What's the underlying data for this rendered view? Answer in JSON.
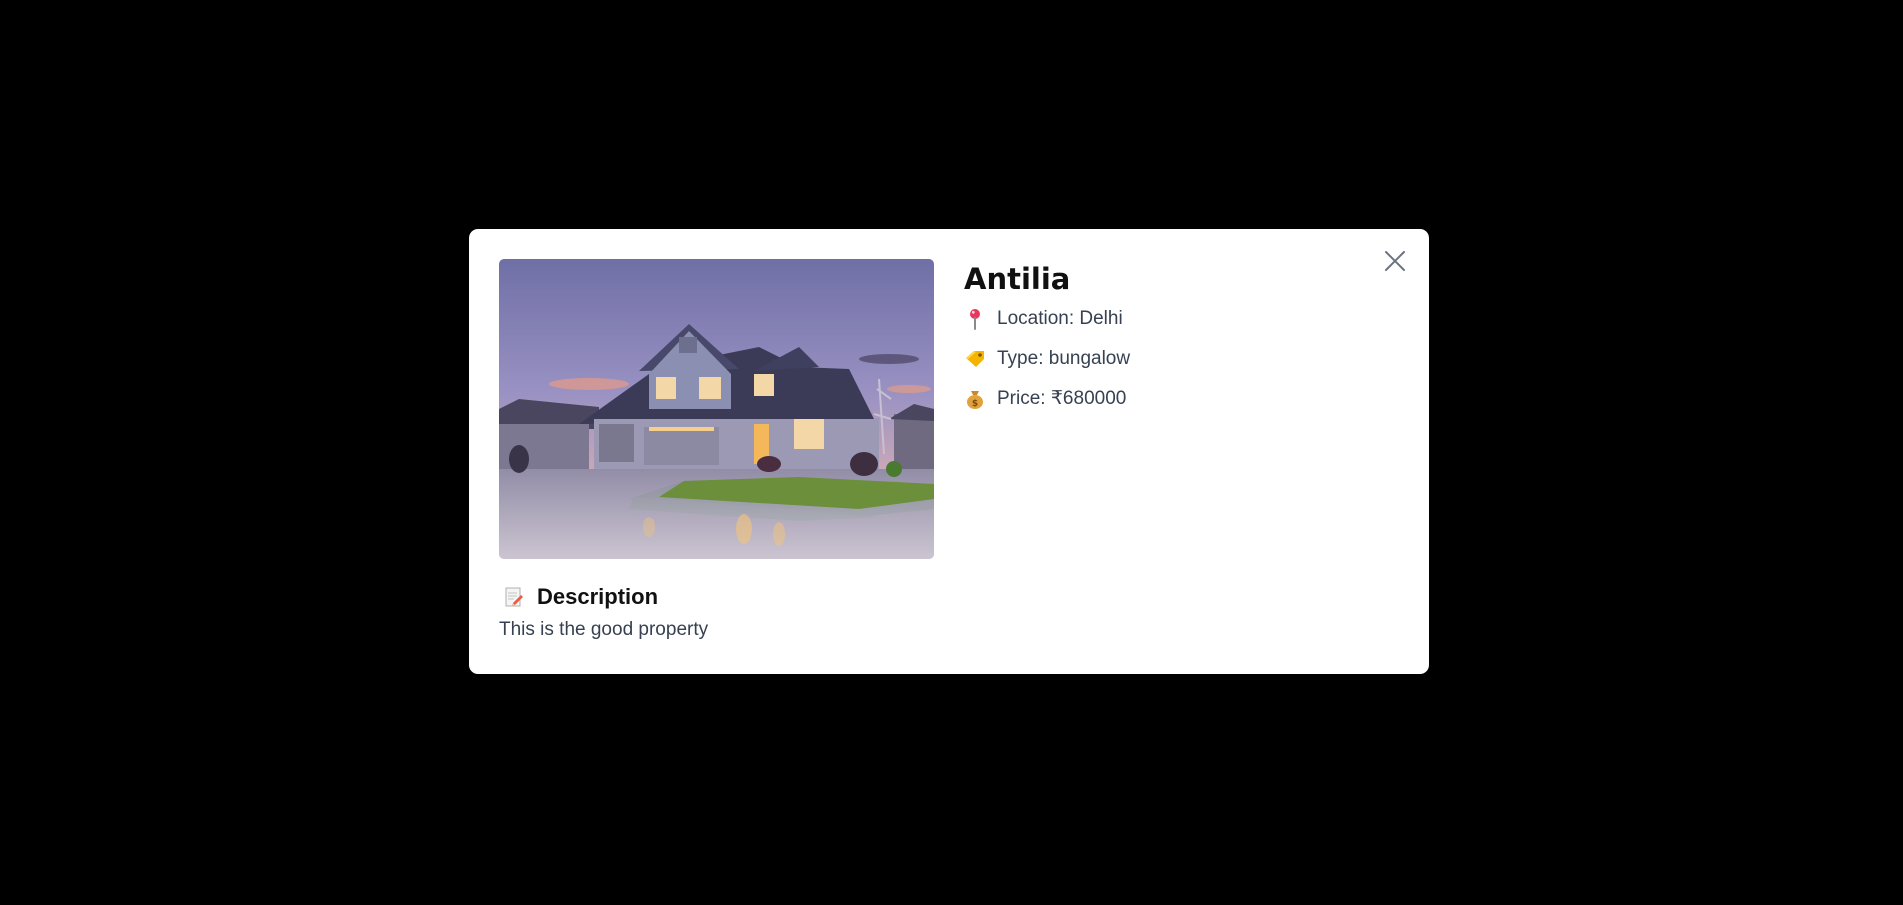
{
  "modal": {
    "title": "Antilia",
    "close_icon": "close-icon",
    "image_alt": "house-photo",
    "details": {
      "location": "Location: Delhi",
      "type": "Type: bungalow",
      "price": "Price: ₹680000"
    },
    "icons": {
      "location": "pin-icon",
      "type": "tag-icon",
      "price": "money-bag-icon",
      "description": "memo-icon"
    },
    "description": {
      "heading": "Description",
      "text": "This is the good property"
    }
  },
  "colors": {
    "backdrop": "#000000",
    "modal_bg": "#ffffff",
    "title": "#111111",
    "body_text": "#374151"
  }
}
